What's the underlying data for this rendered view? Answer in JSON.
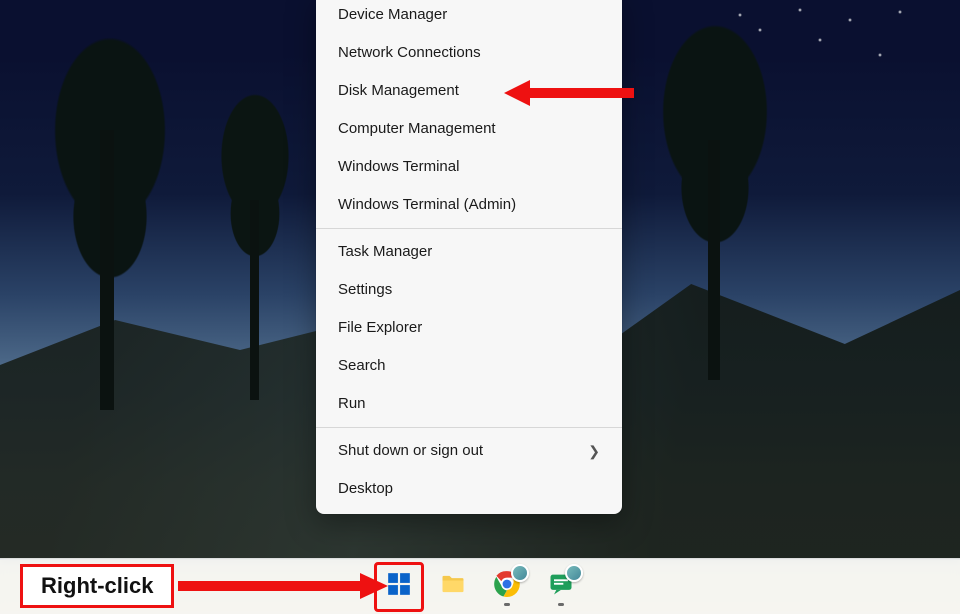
{
  "instruction_label": "Right-click",
  "menu": {
    "groups": [
      [
        {
          "id": "device-manager",
          "label": "Device Manager"
        },
        {
          "id": "network-connections",
          "label": "Network Connections"
        },
        {
          "id": "disk-management",
          "label": "Disk Management"
        },
        {
          "id": "computer-management",
          "label": "Computer Management"
        },
        {
          "id": "windows-terminal",
          "label": "Windows Terminal"
        },
        {
          "id": "windows-terminal-admin",
          "label": "Windows Terminal (Admin)"
        }
      ],
      [
        {
          "id": "task-manager",
          "label": "Task Manager"
        },
        {
          "id": "settings",
          "label": "Settings"
        },
        {
          "id": "file-explorer",
          "label": "File Explorer"
        },
        {
          "id": "search",
          "label": "Search"
        },
        {
          "id": "run",
          "label": "Run"
        }
      ],
      [
        {
          "id": "shut-down-sign-out",
          "label": "Shut down or sign out",
          "submenu": true
        },
        {
          "id": "desktop",
          "label": "Desktop"
        }
      ]
    ]
  },
  "taskbar": {
    "items": [
      {
        "id": "start",
        "icon": "windows-logo-icon",
        "running": false
      },
      {
        "id": "file-explorer",
        "icon": "folder-icon",
        "running": false
      },
      {
        "id": "chrome",
        "icon": "chrome-icon",
        "running": true,
        "avatar": true
      },
      {
        "id": "chat",
        "icon": "chat-icon",
        "running": true,
        "avatar": true
      }
    ]
  },
  "annotations": {
    "highlight_menu_item_id": "disk-management",
    "highlight_taskbar_item_id": "start",
    "arrow_color": "#e11"
  }
}
